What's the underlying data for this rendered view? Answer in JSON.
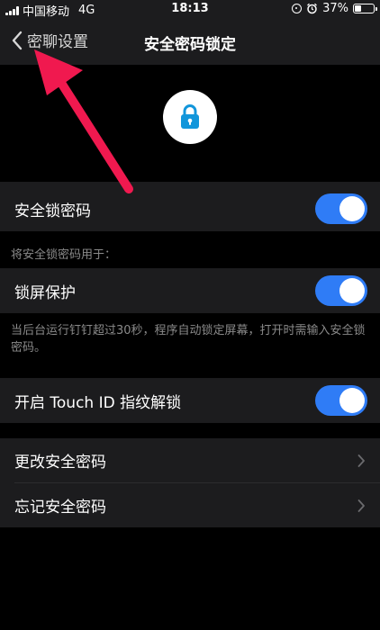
{
  "status_bar": {
    "carrier": "中国移动",
    "network": "4G",
    "time": "18:13",
    "battery_percent": "37%",
    "battery_level": 0.37
  },
  "nav": {
    "back_label": "密聊设置",
    "title": "安全密码锁定"
  },
  "header": {
    "icon": "lock-icon",
    "icon_color": "#1296db"
  },
  "settings": {
    "lock_password": {
      "label": "安全锁密码",
      "enabled": true
    },
    "usage_caption": "将安全锁密码用于：",
    "screen_lock": {
      "label": "锁屏保护",
      "enabled": true
    },
    "screen_lock_note": "当后台运行钉钉超过30秒，程序自动锁定屏幕，打开时需输入安全锁密码。",
    "touch_id": {
      "label": "开启 Touch ID 指纹解锁",
      "enabled": true
    },
    "change_password": {
      "label": "更改安全密码"
    },
    "forgot_password": {
      "label": "忘记安全密码"
    }
  },
  "colors": {
    "toggle_on": "#2f7cf6",
    "background": "#000000",
    "row_background": "#1c1c1e",
    "annotation_arrow": "#f0194f"
  }
}
